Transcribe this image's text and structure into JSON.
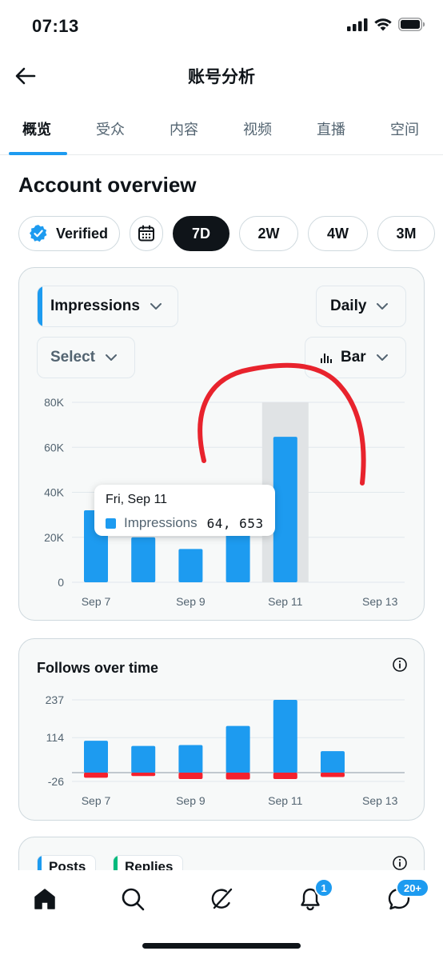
{
  "status_bar": {
    "time": "07:13"
  },
  "header": {
    "title": "账号分析"
  },
  "tabs": [
    {
      "label": "概览",
      "active": true
    },
    {
      "label": "受众"
    },
    {
      "label": "内容"
    },
    {
      "label": "视频"
    },
    {
      "label": "直播"
    },
    {
      "label": "空间"
    }
  ],
  "section_title": "Account overview",
  "filters": {
    "verified_label": "Verified",
    "ranges": [
      "7D",
      "2W",
      "4W",
      "3M"
    ],
    "selected_range": "7D"
  },
  "impressions_card": {
    "metric_dropdown": "Impressions",
    "interval_dropdown": "Daily",
    "compare_dropdown": "Select",
    "chart_type_dropdown": "Bar",
    "tooltip": {
      "date": "Fri, Sep 11",
      "label": "Impressions",
      "value": "64, 653"
    }
  },
  "follows_card": {
    "title": "Follows over time"
  },
  "bottom_card": {
    "tags": [
      "Posts",
      "Replies"
    ]
  },
  "bottom_nav": {
    "notifications_badge": "1",
    "messages_badge": "20+"
  },
  "colors": {
    "accent": "#1d9bf0",
    "negative": "#f4212e",
    "annotation": "#e8232d"
  },
  "chart_data": [
    {
      "type": "bar",
      "title": "Impressions",
      "categories": [
        "Sep 7",
        "Sep 8",
        "Sep 9",
        "Sep 10",
        "Sep 11",
        "Sep 12",
        "Sep 13"
      ],
      "x_tick_labels": [
        "Sep 7",
        "Sep 9",
        "Sep 11",
        "Sep 13"
      ],
      "y_tick_labels": [
        "0",
        "20K",
        "40K",
        "60K",
        "80K"
      ],
      "series": [
        {
          "name": "Impressions",
          "values": [
            32000,
            20000,
            14800,
            24000,
            64653,
            0,
            0
          ]
        }
      ],
      "ylim": [
        0,
        80000
      ],
      "highlighted_category": "Sep 11",
      "grid": true
    },
    {
      "type": "bar",
      "title": "Follows over time",
      "categories": [
        "Sep 7",
        "Sep 8",
        "Sep 9",
        "Sep 10",
        "Sep 11",
        "Sep 12",
        "Sep 13"
      ],
      "x_tick_labels": [
        "Sep 7",
        "Sep 9",
        "Sep 11",
        "Sep 13"
      ],
      "y_tick_labels": [
        "-26",
        "114",
        "237"
      ],
      "series": [
        {
          "values": [
            104,
            87,
            90,
            152,
            237,
            70,
            0
          ]
        },
        {
          "values": [
            -15,
            -10,
            -19,
            -20,
            -19,
            -13,
            0
          ]
        }
      ],
      "ylim": [
        -26,
        237
      ],
      "grid": true
    }
  ]
}
